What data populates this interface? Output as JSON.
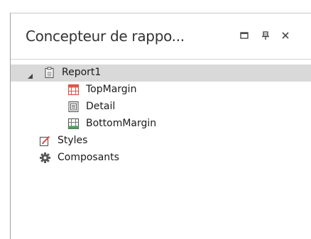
{
  "panel": {
    "title": "Concepteur de rappo..."
  },
  "tree": {
    "root": {
      "label": "Report1",
      "icon": "report-icon",
      "expanded": true,
      "children": [
        {
          "label": "TopMargin",
          "icon": "top-margin-band-icon"
        },
        {
          "label": "Detail",
          "icon": "detail-band-icon"
        },
        {
          "label": "BottomMargin",
          "icon": "bottom-margin-band-icon"
        }
      ]
    },
    "styles": {
      "label": "Styles",
      "icon": "styles-icon"
    },
    "components": {
      "label": "Composants",
      "icon": "components-gear-icon"
    }
  },
  "colors": {
    "selection": "#d9d9d9",
    "band_red": "#e0584a",
    "band_green": "#4aa35a",
    "icon_gray": "#5a5a5a"
  }
}
